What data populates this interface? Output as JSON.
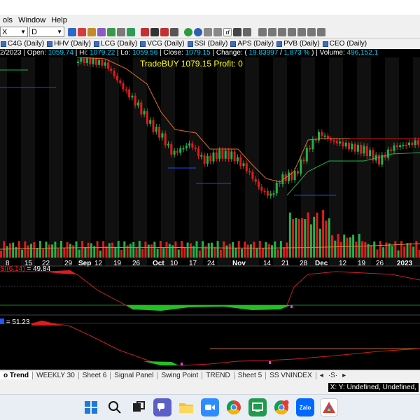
{
  "menu": {
    "items": [
      "ols",
      "Window",
      "Help"
    ]
  },
  "toolbar": {
    "symbol": "X",
    "interval": "D"
  },
  "indicator_tabs": [
    "C4G (Daily)",
    "HHV (Daily)",
    "LCG (Daily)",
    "VCG (Daily)",
    "SSI (Daily)",
    "APS (Daily)",
    "PVB (Daily)",
    "CEO (Daily)"
  ],
  "quote": {
    "date": "2/2023",
    "open_label": "Open:",
    "open": "1059.74",
    "hi_label": "Hi:",
    "hi": "1079.22",
    "lo_label": "Lo:",
    "lo": "1059.56",
    "close_label": "Close:",
    "close": "1079.15",
    "change_label": "Change: (",
    "change": "19.83997",
    "change_pct": "1.873 %",
    "volume_label": "Volume:",
    "volume": "496,152,1"
  },
  "trade": {
    "text": "TradeBUY  1079.15  Profit: 0"
  },
  "x_axis": {
    "labels": [
      "8",
      "15",
      "22",
      "29",
      "Sep",
      "12",
      "19",
      "26",
      "Oct",
      "10",
      "17",
      "24",
      "Nov",
      "14",
      "21",
      "28",
      "Dec",
      "12",
      "19",
      "26",
      "2023"
    ]
  },
  "rsi": {
    "label": "SI(6,14)",
    "value": "= 49.84"
  },
  "osc": {
    "value": "= 51.23"
  },
  "sheet_tabs": [
    "o Trend",
    "WEEKLY 30",
    "Sheet 6",
    "Signal Panel",
    "Swing Point",
    "TREND",
    "Sheet 5",
    "SS VNINDEX"
  ],
  "status": {
    "text": "X: Y: Undefined, Undefined,"
  },
  "taskbar": {
    "icons": [
      "windows-start-icon",
      "search-icon",
      "task-view-icon",
      "teams-icon",
      "file-explorer-icon",
      "zoom-icon",
      "chrome-icon",
      "green-app-icon",
      "chrome-profile-icon",
      "zalo-icon",
      "amibroker-icon"
    ],
    "zalo_label": "Zalo"
  },
  "colors": {
    "up": "#21b24b",
    "down": "#e01b1b",
    "background": "#000000",
    "trade_text": "#ffff00",
    "quote_value": "#00d5ff"
  }
}
